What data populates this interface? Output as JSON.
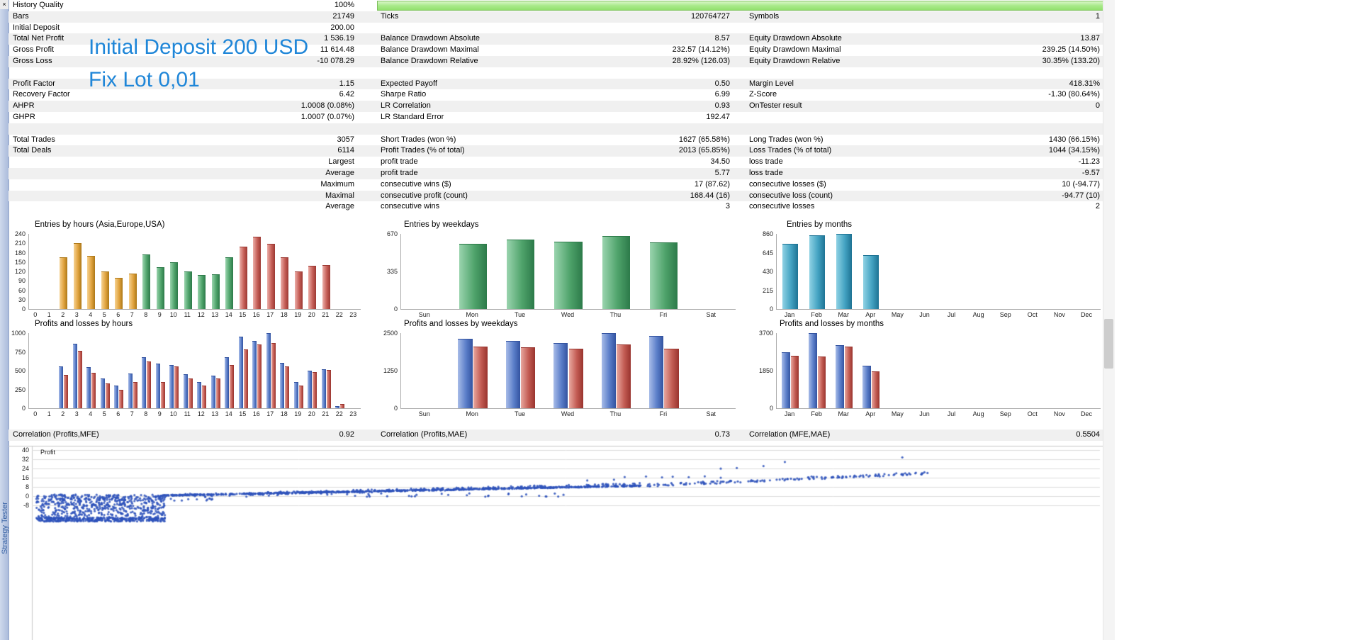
{
  "panel": {
    "close_icon": "×",
    "vertical_title": "Strategy Tester"
  },
  "overlay": {
    "line1": "Initial Deposit 200 USD",
    "line2": "Fix Lot 0,01"
  },
  "colors": {
    "annotation_blue": "#1f86d8",
    "progress_green": "#a9ea8a",
    "palettes": {
      "orange": {
        "light": "#F6D292",
        "base": "#E0A33E",
        "dark": "#AD7818"
      },
      "green": {
        "light": "#9AD4AE",
        "base": "#4FA36B",
        "dark": "#2C7A49"
      },
      "red": {
        "light": "#ECAFA9",
        "base": "#C66058",
        "dark": "#9C3832"
      },
      "teal": {
        "light": "#8FD2E4",
        "base": "#44A3C2",
        "dark": "#1E7394"
      },
      "blue": {
        "light": "#A8BCE8",
        "base": "#5B7EC9",
        "dark": "#3353A0"
      },
      "loss": {
        "light": "#E8A79F",
        "base": "#C25B52",
        "dark": "#99342E"
      }
    }
  },
  "stats": {
    "rows": [
      {
        "l1": "History Quality",
        "v1": "100%",
        "l2": "",
        "v2": "",
        "l3": "",
        "v3": "",
        "shaded": false,
        "progress": true
      },
      {
        "l1": "Bars",
        "v1": "21749",
        "l2": "Ticks",
        "v2": "120764727",
        "l3": "Symbols",
        "v3": "1",
        "shaded": true
      },
      {
        "l1": "Initial Deposit",
        "v1": "200.00",
        "l2": "",
        "v2": "",
        "l3": "",
        "v3": "",
        "shaded": false
      },
      {
        "l1": "Total Net Profit",
        "v1": "1 536.19",
        "l2": "Balance Drawdown Absolute",
        "v2": "8.57",
        "l3": "Equity Drawdown Absolute",
        "v3": "13.87",
        "shaded": true
      },
      {
        "l1": "Gross Profit",
        "v1": "11 614.48",
        "l2": "Balance Drawdown Maximal",
        "v2": "232.57 (14.12%)",
        "l3": "Equity Drawdown Maximal",
        "v3": "239.25 (14.50%)",
        "shaded": false
      },
      {
        "l1": "Gross Loss",
        "v1": "-10 078.29",
        "l2": "Balance Drawdown Relative",
        "v2": "28.92% (126.03)",
        "l3": "Equity Drawdown Relative",
        "v3": "30.35% (133.20)",
        "shaded": true
      },
      {
        "l1": "",
        "v1": "",
        "l2": "",
        "v2": "",
        "l3": "",
        "v3": "",
        "shaded": false
      },
      {
        "l1": "Profit Factor",
        "v1": "1.15",
        "l2": "Expected Payoff",
        "v2": "0.50",
        "l3": "Margin Level",
        "v3": "418.31%",
        "shaded": true
      },
      {
        "l1": "Recovery Factor",
        "v1": "6.42",
        "l2": "Sharpe Ratio",
        "v2": "6.99",
        "l3": "Z-Score",
        "v3": "-1.30 (80.64%)",
        "shaded": false
      },
      {
        "l1": "AHPR",
        "v1": "1.0008 (0.08%)",
        "l2": "LR Correlation",
        "v2": "0.93",
        "l3": "OnTester result",
        "v3": "0",
        "shaded": true
      },
      {
        "l1": "GHPR",
        "v1": "1.0007 (0.07%)",
        "l2": "LR Standard Error",
        "v2": "192.47",
        "l3": "",
        "v3": "",
        "shaded": false
      },
      {
        "l1": "",
        "v1": "",
        "l2": "",
        "v2": "",
        "l3": "",
        "v3": "",
        "shaded": true
      },
      {
        "l1": "Total Trades",
        "v1": "3057",
        "l2": "Short Trades (won %)",
        "v2": "1627 (65.58%)",
        "l3": "Long Trades (won %)",
        "v3": "1430 (66.15%)",
        "shaded": false
      },
      {
        "l1": "Total Deals",
        "v1": "6114",
        "l2": "Profit Trades (% of total)",
        "v2": "2013 (65.85%)",
        "l3": "Loss Trades (% of total)",
        "v3": "1044 (34.15%)",
        "shaded": true
      },
      {
        "l1": "",
        "v1": "Largest",
        "l2": "profit trade",
        "v2": "34.50",
        "l3": "loss trade",
        "v3": "-11.23",
        "shaded": false
      },
      {
        "l1": "",
        "v1": "Average",
        "l2": "profit trade",
        "v2": "5.77",
        "l3": "loss trade",
        "v3": "-9.57",
        "shaded": true
      },
      {
        "l1": "",
        "v1": "Maximum",
        "l2": "consecutive wins ($)",
        "v2": "17 (87.62)",
        "l3": "consecutive losses ($)",
        "v3": "10 (-94.77)",
        "shaded": false
      },
      {
        "l1": "",
        "v1": "Maximal",
        "l2": "consecutive profit (count)",
        "v2": "168.44 (16)",
        "l3": "consecutive loss (count)",
        "v3": "-94.77 (10)",
        "shaded": true
      },
      {
        "l1": "",
        "v1": "Average",
        "l2": "consecutive wins",
        "v2": "3",
        "l3": "consecutive losses",
        "v3": "2",
        "shaded": false
      }
    ]
  },
  "correlations": {
    "l1": "Correlation (Profits,MFE)",
    "v1": "0.92",
    "l2": "Correlation (Profits,MAE)",
    "v2": "0.73",
    "l3": "Correlation (MFE,MAE)",
    "v3": "0.5504"
  },
  "chart_data": [
    {
      "id": "entries_by_hours",
      "type": "bar",
      "title": "Entries by hours (Asia,Europe,USA)",
      "categories": [
        "0",
        "1",
        "2",
        "3",
        "4",
        "5",
        "6",
        "7",
        "8",
        "9",
        "10",
        "11",
        "12",
        "13",
        "14",
        "15",
        "16",
        "17",
        "18",
        "19",
        "20",
        "21",
        "22",
        "23"
      ],
      "values": [
        0,
        0,
        165,
        210,
        170,
        120,
        100,
        113,
        175,
        133,
        150,
        120,
        108,
        110,
        165,
        200,
        232,
        208,
        165,
        120,
        138,
        140,
        0,
        0
      ],
      "bar_palette": [
        "orange",
        "orange",
        "orange",
        "orange",
        "orange",
        "orange",
        "orange",
        "orange",
        "green",
        "green",
        "green",
        "green",
        "green",
        "green",
        "green",
        "red",
        "red",
        "red",
        "red",
        "red",
        "red",
        "red",
        "red",
        "red"
      ],
      "yticks": [
        0,
        30,
        60,
        90,
        120,
        150,
        180,
        210,
        240
      ],
      "ymax": 240,
      "legend_hint": "orange=Asia, green=Europe, red=USA"
    },
    {
      "id": "entries_by_weekdays",
      "type": "bar",
      "title": "Entries by weekdays",
      "categories": [
        "Sun",
        "Mon",
        "Tue",
        "Wed",
        "Thu",
        "Fri",
        "Sat"
      ],
      "values": [
        0,
        580,
        618,
        600,
        648,
        597,
        0
      ],
      "palette": "green",
      "yticks": [
        0,
        335,
        670
      ],
      "ymax": 670
    },
    {
      "id": "entries_by_months",
      "type": "bar",
      "title": "Entries by months",
      "categories": [
        "Jan",
        "Feb",
        "Mar",
        "Apr",
        "May",
        "Jun",
        "Jul",
        "Aug",
        "Sep",
        "Oct",
        "Nov",
        "Dec"
      ],
      "values": [
        750,
        845,
        860,
        618,
        0,
        0,
        0,
        0,
        0,
        0,
        0,
        0
      ],
      "palette": "teal",
      "yticks": [
        0,
        215,
        430,
        645,
        860
      ],
      "ymax": 860
    },
    {
      "id": "pl_by_hours",
      "type": "bar",
      "title": "Profits and losses by hours",
      "categories": [
        "0",
        "1",
        "2",
        "3",
        "4",
        "5",
        "6",
        "7",
        "8",
        "9",
        "10",
        "11",
        "12",
        "13",
        "14",
        "15",
        "16",
        "17",
        "18",
        "19",
        "20",
        "21",
        "22",
        "23"
      ],
      "series": [
        {
          "name": "profit",
          "palette": "blue",
          "values": [
            0,
            0,
            560,
            860,
            550,
            400,
            300,
            460,
            680,
            590,
            580,
            450,
            350,
            430,
            680,
            950,
            900,
            1000,
            600,
            350,
            500,
            520,
            30,
            0
          ]
        },
        {
          "name": "loss",
          "palette": "loss",
          "values": [
            0,
            0,
            440,
            760,
            470,
            330,
            250,
            350,
            620,
            350,
            560,
            400,
            300,
            400,
            580,
            780,
            850,
            870,
            560,
            300,
            480,
            510,
            60,
            0
          ]
        }
      ],
      "yticks": [
        0,
        250,
        500,
        750,
        1000
      ],
      "ymax": 1000
    },
    {
      "id": "pl_by_weekdays",
      "type": "bar",
      "title": "Profits and losses by weekdays",
      "categories": [
        "Sun",
        "Mon",
        "Tue",
        "Wed",
        "Thu",
        "Fri",
        "Sat"
      ],
      "series": [
        {
          "name": "profit",
          "palette": "blue",
          "values": [
            0,
            2300,
            2230,
            2180,
            2500,
            2400,
            0
          ]
        },
        {
          "name": "loss",
          "palette": "loss",
          "values": [
            0,
            2050,
            2030,
            1980,
            2120,
            1990,
            0
          ]
        }
      ],
      "yticks": [
        0,
        1250,
        2500
      ],
      "ymax": 2500
    },
    {
      "id": "pl_by_months",
      "type": "bar",
      "title": "Profits and losses by months",
      "categories": [
        "Jan",
        "Feb",
        "Mar",
        "Apr",
        "May",
        "Jun",
        "Jul",
        "Aug",
        "Sep",
        "Oct",
        "Nov",
        "Dec"
      ],
      "series": [
        {
          "name": "profit",
          "palette": "blue",
          "values": [
            2750,
            3700,
            3120,
            2100,
            0,
            0,
            0,
            0,
            0,
            0,
            0,
            0
          ]
        },
        {
          "name": "loss",
          "palette": "loss",
          "values": [
            2600,
            2550,
            3050,
            1800,
            0,
            0,
            0,
            0,
            0,
            0,
            0,
            0
          ]
        }
      ],
      "yticks": [
        0,
        1850,
        3700
      ],
      "ymax": 3700
    },
    {
      "id": "profit_scatter",
      "type": "scatter",
      "ylabel": "Profit",
      "yticks": [
        40,
        32,
        24,
        16,
        8,
        0,
        -8
      ],
      "point_color": "#2e52bb",
      "clusters": [
        {
          "kind": "box",
          "n": 550,
          "x": [
            0.004,
            0.125
          ],
          "y": [
            -20,
            1
          ]
        },
        {
          "kind": "box",
          "n": 300,
          "x": [
            0.004,
            0.125
          ],
          "y": [
            -22,
            -18.5
          ]
        },
        {
          "kind": "box",
          "n": 90,
          "x": [
            0.008,
            0.17
          ],
          "y": [
            -4,
            1.5
          ]
        },
        {
          "kind": "trend",
          "n": 700,
          "x": [
            0.12,
            0.57
          ],
          "y": [
            0.5,
            9
          ],
          "jitter": 0.4
        },
        {
          "kind": "trend",
          "n": 220,
          "x": [
            0.2,
            0.57
          ],
          "y": [
            1.8,
            10
          ],
          "jitter": 1.3
        },
        {
          "kind": "trend",
          "n": 150,
          "x": [
            0.57,
            0.84
          ],
          "y": [
            9,
            20
          ],
          "jitter": 1.1
        },
        {
          "kind": "box",
          "n": 45,
          "x": [
            0.13,
            0.5
          ],
          "y": [
            -0.5,
            2.5
          ]
        }
      ],
      "outliers": [
        [
          0.52,
          13.5
        ],
        [
          0.545,
          14.2
        ],
        [
          0.555,
          16.5
        ],
        [
          0.575,
          17
        ],
        [
          0.59,
          16.2
        ],
        [
          0.6,
          16.8
        ],
        [
          0.615,
          16.4
        ],
        [
          0.63,
          17.1
        ],
        [
          0.645,
          15.9
        ],
        [
          0.645,
          23.8
        ],
        [
          0.66,
          24.3
        ],
        [
          0.685,
          26
        ],
        [
          0.705,
          29.5
        ],
        [
          0.73,
          17
        ],
        [
          0.75,
          16.6
        ],
        [
          0.77,
          17.3
        ],
        [
          0.815,
          33.5
        ]
      ]
    }
  ]
}
